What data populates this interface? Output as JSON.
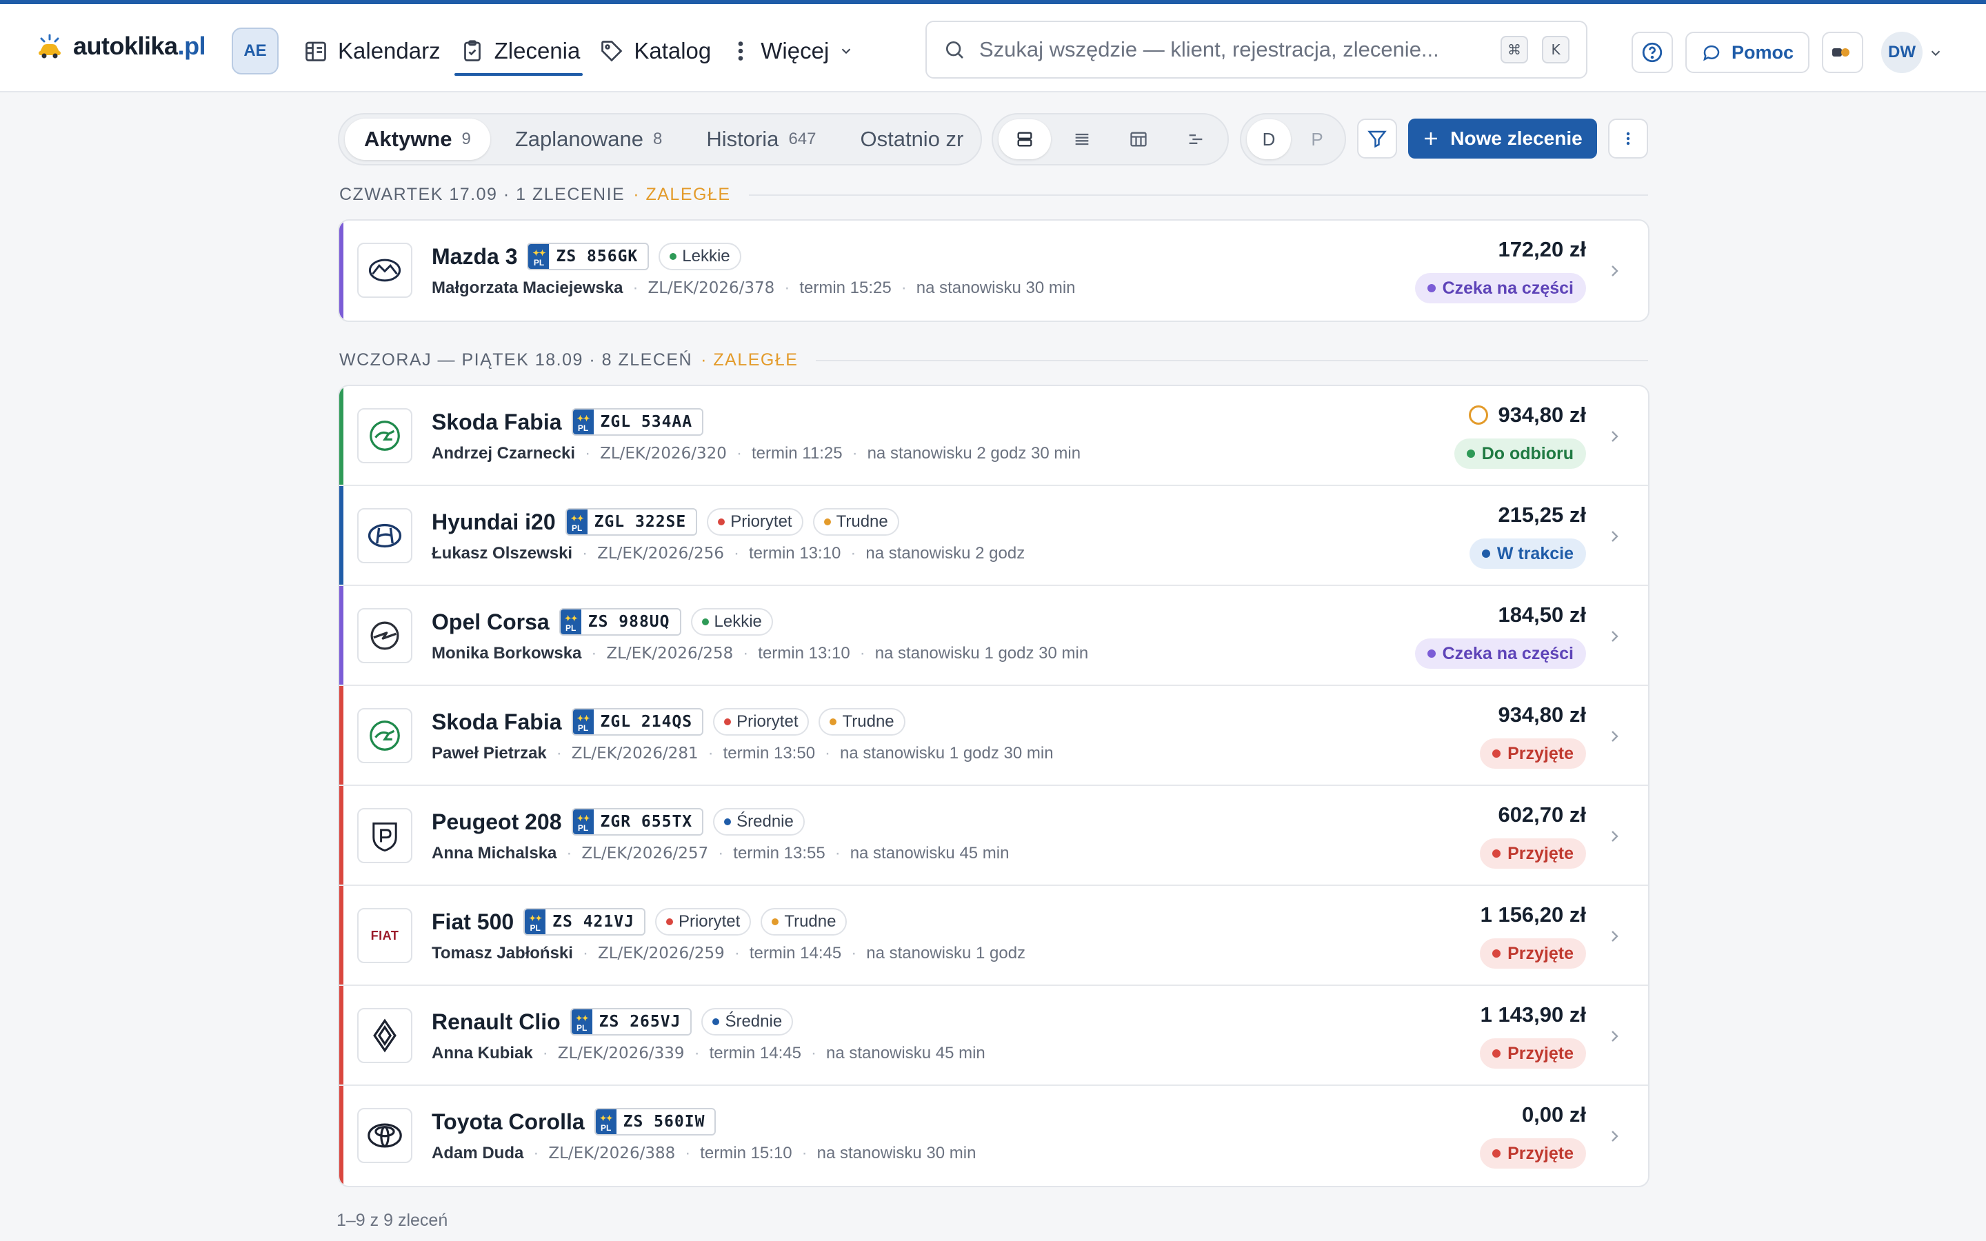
{
  "app": {
    "brand_main": "autoklika",
    "brand_tld": ".pl",
    "workspace_badge": "AE"
  },
  "nav": [
    {
      "label": "Kalendarz",
      "icon": "calendar-icon",
      "active": false
    },
    {
      "label": "Zlecenia",
      "icon": "clipboard-icon",
      "active": true
    },
    {
      "label": "Katalog",
      "icon": "tag-icon",
      "active": false
    },
    {
      "label": "Więcej",
      "icon": "more-vertical-icon",
      "active": false
    }
  ],
  "search": {
    "placeholder": "Szukaj wszędzie — klient, rejestracja, zlecenie...",
    "shortcut_mod": "⌘",
    "shortcut_key": "K"
  },
  "header_actions": {
    "help_icon": "help-circle-icon",
    "pomoc_label": "Pomoc",
    "user_initials": "DW"
  },
  "tabs": [
    {
      "label": "Aktywne",
      "count": "9",
      "active": true
    },
    {
      "label": "Zaplanowane",
      "count": "8",
      "active": false
    },
    {
      "label": "Historia",
      "count": "647",
      "active": false
    },
    {
      "label": "Ostatnio zr",
      "count": "",
      "active": false
    }
  ],
  "views": [
    "cards-view-icon",
    "list-view-icon",
    "table-view-icon",
    "timeline-view-icon"
  ],
  "dp": {
    "d": "D",
    "p": "P"
  },
  "toolbar": {
    "new_order": "Nowe zlecenie"
  },
  "colors": {
    "accent": "#1f5ca8",
    "purple": "#7b5cd6",
    "green": "#2e9a57",
    "blue": "#1f5ca8",
    "red": "#d9463e",
    "orange": "#e39b2b"
  },
  "groups": [
    {
      "title": "CZWARTEK 17.09 · 1 ZLECENIE",
      "late": "· ZALEGŁE"
    },
    {
      "title": "WCZORAJ — PIĄTEK 18.09 · 8 ZLECEŃ",
      "late": "· ZALEGŁE"
    }
  ],
  "orders_g1": [
    {
      "model": "Mazda 3",
      "brand_icon": "mazda-logo-icon",
      "plate": "ZS 856GK",
      "tags": [
        {
          "label": "Lekkie",
          "color": "#2e9a57"
        }
      ],
      "customer": "Małgorzata Maciejewska",
      "ref": "ZL/EK/2026/378",
      "term": "termin 15:25",
      "station": "na stanowisku 30 min",
      "price": "172,20 zł",
      "status": "Czeka na części",
      "status_kind": "purple"
    }
  ],
  "orders_g2": [
    {
      "model": "Skoda Fabia",
      "brand_icon": "skoda-logo-icon",
      "plate": "ZGL 534AA",
      "tags": [],
      "customer": "Andrzej Czarnecki",
      "ref": "ZL/EK/2026/320",
      "term": "termin 11:25",
      "station": "na stanowisku 2 godz 30 min",
      "price": "934,80 zł",
      "status": "Do odbioru",
      "status_kind": "green",
      "ring": true
    },
    {
      "model": "Hyundai i20",
      "brand_icon": "hyundai-logo-icon",
      "plate": "ZGL 322SE",
      "tags": [
        {
          "label": "Priorytet",
          "color": "#d9463e"
        },
        {
          "label": "Trudne",
          "color": "#e39b2b"
        }
      ],
      "customer": "Łukasz Olszewski",
      "ref": "ZL/EK/2026/256",
      "term": "termin 13:10",
      "station": "na stanowisku 2 godz",
      "price": "215,25 zł",
      "status": "W trakcie",
      "status_kind": "blue"
    },
    {
      "model": "Opel Corsa",
      "brand_icon": "opel-logo-icon",
      "plate": "ZS 988UQ",
      "tags": [
        {
          "label": "Lekkie",
          "color": "#2e9a57"
        }
      ],
      "customer": "Monika Borkowska",
      "ref": "ZL/EK/2026/258",
      "term": "termin 13:10",
      "station": "na stanowisku 1 godz 30 min",
      "price": "184,50 zł",
      "status": "Czeka na części",
      "status_kind": "purple"
    },
    {
      "model": "Skoda Fabia",
      "brand_icon": "skoda-logo-icon",
      "plate": "ZGL 214QS",
      "tags": [
        {
          "label": "Priorytet",
          "color": "#d9463e"
        },
        {
          "label": "Trudne",
          "color": "#e39b2b"
        }
      ],
      "customer": "Paweł Pietrzak",
      "ref": "ZL/EK/2026/281",
      "term": "termin 13:50",
      "station": "na stanowisku 1 godz 30 min",
      "price": "934,80 zł",
      "status": "Przyjęte",
      "status_kind": "red"
    },
    {
      "model": "Peugeot 208",
      "brand_icon": "peugeot-logo-icon",
      "plate": "ZGR 655TX",
      "tags": [
        {
          "label": "Średnie",
          "color": "#1f5ca8"
        }
      ],
      "customer": "Anna Michalska",
      "ref": "ZL/EK/2026/257",
      "term": "termin 13:55",
      "station": "na stanowisku 45 min",
      "price": "602,70 zł",
      "status": "Przyjęte",
      "status_kind": "red"
    },
    {
      "model": "Fiat 500",
      "brand_icon": "fiat-logo-icon",
      "brand_text": "FIAT",
      "plate": "ZS 421VJ",
      "tags": [
        {
          "label": "Priorytet",
          "color": "#d9463e"
        },
        {
          "label": "Trudne",
          "color": "#e39b2b"
        }
      ],
      "customer": "Tomasz Jabłoński",
      "ref": "ZL/EK/2026/259",
      "term": "termin 14:45",
      "station": "na stanowisku 1 godz",
      "price": "1 156,20 zł",
      "status": "Przyjęte",
      "status_kind": "red"
    },
    {
      "model": "Renault Clio",
      "brand_icon": "renault-logo-icon",
      "plate": "ZS 265VJ",
      "tags": [
        {
          "label": "Średnie",
          "color": "#1f5ca8"
        }
      ],
      "customer": "Anna Kubiak",
      "ref": "ZL/EK/2026/339",
      "term": "termin 14:45",
      "station": "na stanowisku 45 min",
      "price": "1 143,90 zł",
      "status": "Przyjęte",
      "status_kind": "red"
    },
    {
      "model": "Toyota Corolla",
      "brand_icon": "toyota-logo-icon",
      "plate": "ZS 560IW",
      "tags": [],
      "customer": "Adam Duda",
      "ref": "ZL/EK/2026/388",
      "term": "termin 15:10",
      "station": "na stanowisku 30 min",
      "price": "0,00 zł",
      "status": "Przyjęte",
      "status_kind": "red"
    }
  ],
  "footer": {
    "summary": "1–9 z 9 zleceń"
  }
}
